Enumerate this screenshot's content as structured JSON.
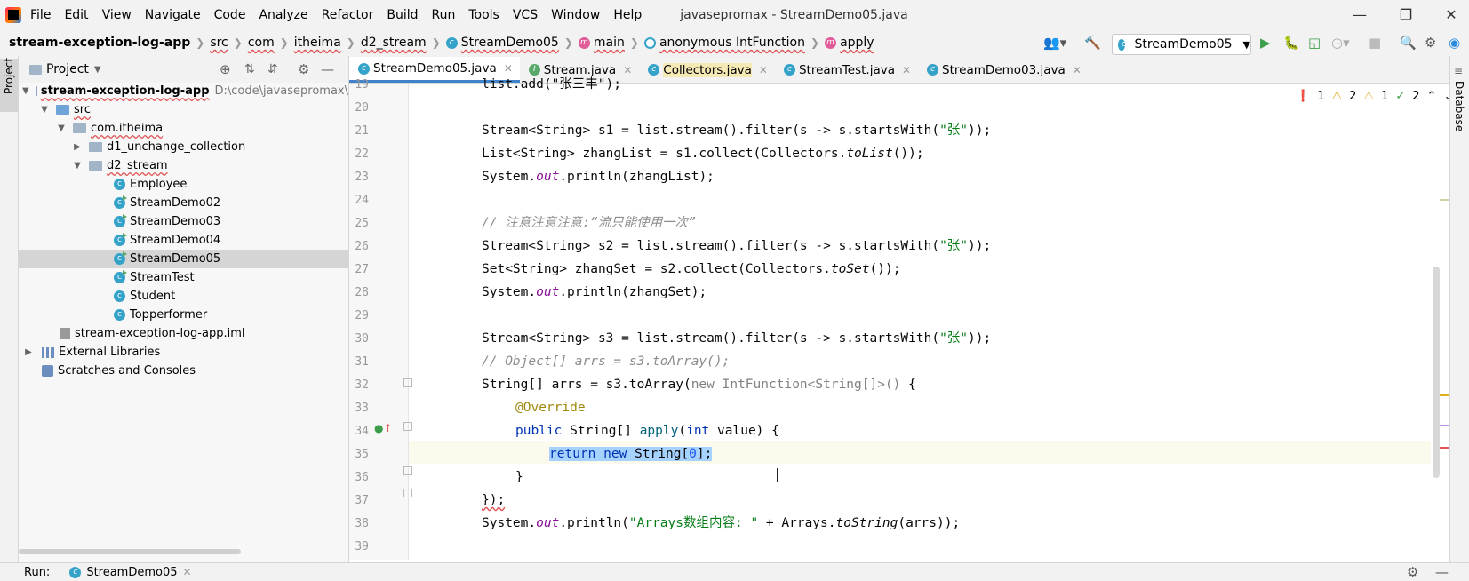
{
  "menu": [
    "File",
    "Edit",
    "View",
    "Navigate",
    "Code",
    "Analyze",
    "Refactor",
    "Build",
    "Run",
    "Tools",
    "VCS",
    "Window",
    "Help"
  ],
  "window_title": "javasepromax - StreamDemo05.java",
  "breadcrumb": {
    "project": "stream-exception-log-app",
    "items": [
      "src",
      "com",
      "itheima",
      "d2_stream",
      "StreamDemo05",
      "main",
      "anonymous IntFunction",
      "apply"
    ]
  },
  "run_config": "StreamDemo05",
  "project_panel": {
    "title": "Project",
    "root": "stream-exception-log-app",
    "root_path": "D:\\code\\javasepromax\\",
    "tree": {
      "src": "src",
      "pkg": "com.itheima",
      "d1": "d1_unchange_collection",
      "d2": "d2_stream",
      "classes": [
        "Employee",
        "StreamDemo02",
        "StreamDemo03",
        "StreamDemo04",
        "StreamDemo05",
        "StreamTest",
        "Student",
        "Topperformer"
      ],
      "iml": "stream-exception-log-app.iml",
      "external": "External Libraries",
      "scratches": "Scratches and Consoles"
    }
  },
  "tabs": [
    "StreamDemo05.java",
    "Stream.java",
    "Collectors.java",
    "StreamTest.java",
    "StreamDemo03.java"
  ],
  "inspections": {
    "errors": "1",
    "warnings": "2",
    "weak": "1",
    "ok": "2"
  },
  "code": {
    "line_numbers": [
      "19",
      "20",
      "21",
      "22",
      "23",
      "24",
      "25",
      "26",
      "27",
      "28",
      "29",
      "30",
      "31",
      "32",
      "33",
      "34",
      "35",
      "36",
      "37",
      "38",
      "39"
    ],
    "l19": "list.add(\"张三丰\");",
    "l21a": "Stream<String> s1 = list.stream().filter(s -> s.startsWith(",
    "l21s": "\"张\"",
    "l21b": "));",
    "l22a": "List<String> zhangList = s1.collect(Collectors.",
    "l22i": "toList",
    "l22b": "());",
    "l23a": "System.",
    "l23f": "out",
    "l23b": ".println(zhangList);",
    "l25": "// 注意注意注意:“流只能使用一次”",
    "l26a": "Stream<String> s2 = list.stream().filter(s -> s.startsWith(",
    "l26s": "\"张\"",
    "l26b": "));",
    "l27a": "Set<String> zhangSet = s2.collect(Collectors.",
    "l27i": "toSet",
    "l27b": "());",
    "l28a": "System.",
    "l28f": "out",
    "l28b": ".println(zhangSet);",
    "l30a": "Stream<String> s3 = list.stream().filter(s -> s.startsWith(",
    "l30s": "\"张\"",
    "l30b": "));",
    "l31": "// Object[] arrs = s3.toArray();",
    "l32a": "String[] arrs = s3.toArray(",
    "l32g": "new IntFunction<String[]>()",
    "l32b": " {",
    "l33": "@Override",
    "l34k": "public",
    "l34a": " String[] ",
    "l34m": "apply",
    "l34b": "(",
    "l34k2": "int",
    "l34c": " value) {",
    "l35k": "return new",
    "l35a": " String[",
    "l35n": "0",
    "l35b": "];",
    "l36": "}",
    "l37": "});",
    "l38a": "System.",
    "l38f": "out",
    "l38b": ".println(",
    "l38s": "\"Arrays数组内容: \"",
    "l38c": " + Arrays.",
    "l38i": "toString",
    "l38d": "(arrs));"
  },
  "run_bar": {
    "label": "Run:",
    "config": "StreamDemo05"
  },
  "right_stripe": "Database",
  "left_stripe": "Project"
}
